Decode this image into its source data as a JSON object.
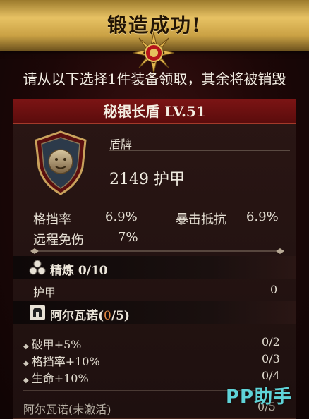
{
  "banner": {
    "title": "锻造成功!"
  },
  "prompt": "请从以下选择1件装备领取，其余将被销毁",
  "item": {
    "name_level": "秘银长盾 LV.51",
    "type": "盾牌",
    "armor_value": "2149 护甲",
    "stats": [
      {
        "label": "格挡率",
        "value": "6.9%"
      },
      {
        "label": "暴击抵抗",
        "value": "6.9%"
      },
      {
        "label": "远程免伤",
        "value": "7%"
      }
    ]
  },
  "refine": {
    "label": "精炼 0/10",
    "rows": [
      {
        "label": "护甲",
        "value": "0"
      }
    ]
  },
  "set": {
    "name": "阿尔瓦诺(",
    "count": "0",
    "total": "/5)",
    "bonuses": [
      {
        "label": "破甲+5%",
        "value": "0/2"
      },
      {
        "label": "格挡率+10%",
        "value": "0/3"
      },
      {
        "label": "生命+10%",
        "value": "0/4"
      }
    ],
    "footer_label": "阿尔瓦诺(未激活)",
    "footer_value": "0/5"
  },
  "watermark": "PP助手",
  "colors": {
    "header_red": "#7b1414",
    "gold": "#e7c264",
    "highlight": "#e48a44",
    "watermark": "#5fd3d8"
  }
}
